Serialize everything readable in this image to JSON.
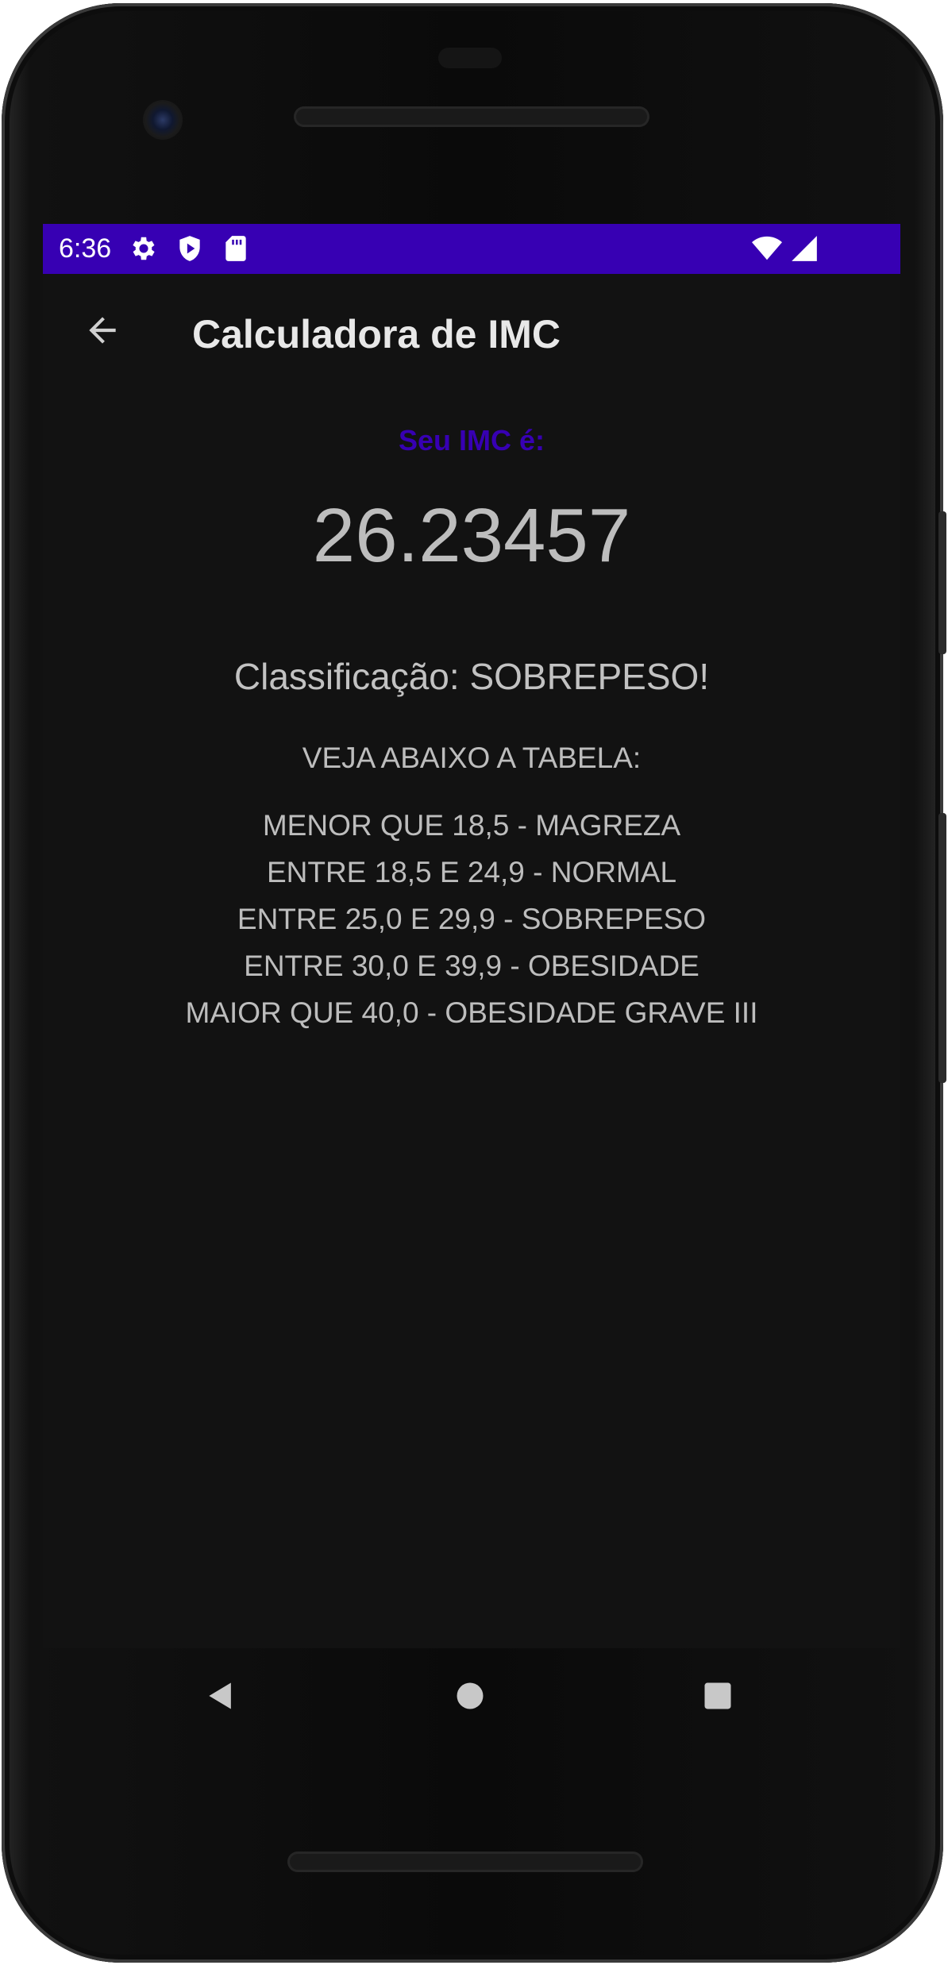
{
  "status_bar": {
    "time": "6:36",
    "left_icons": [
      "settings-icon",
      "play-protect-icon",
      "sd-card-icon"
    ],
    "right_icons": [
      "wifi-icon",
      "signal-icon"
    ],
    "background_color": "#3700b3"
  },
  "app_bar": {
    "title": "Calculadora de IMC",
    "back_icon": "arrow-back-icon"
  },
  "result": {
    "label": "Seu IMC é:",
    "value": "26.23457",
    "classification": "Classificação: SOBREPESO!",
    "label_color": "#3700b3"
  },
  "table": {
    "header": "VEJA ABAIXO A TABELA:",
    "rows": [
      "MENOR QUE 18,5 - MAGREZA",
      "ENTRE 18,5 E 24,9 - NORMAL",
      "ENTRE 25,0 E 29,9 - SOBREPESO",
      "ENTRE 30,0 E 39,9 - OBESIDADE",
      "MAIOR QUE 40,0 - OBESIDADE GRAVE III"
    ]
  },
  "nav_bar": {
    "back_icon": "nav-back-icon",
    "home_icon": "nav-home-icon",
    "recents_icon": "nav-recents-icon"
  }
}
